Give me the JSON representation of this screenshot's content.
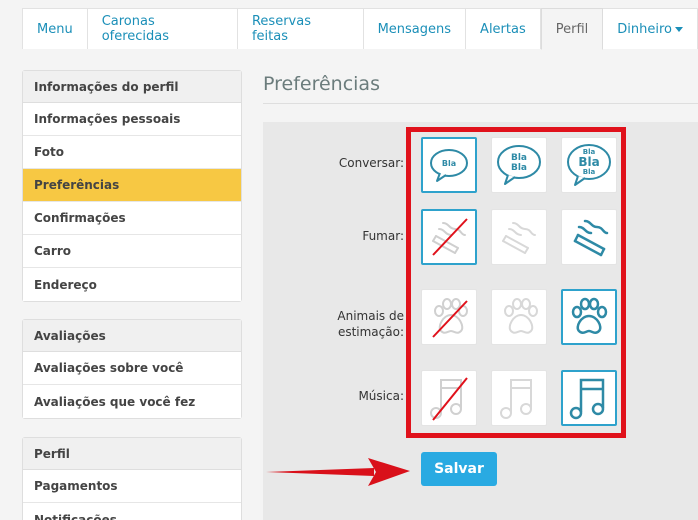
{
  "nav": {
    "tabs": [
      {
        "label": "Menu"
      },
      {
        "label": "Caronas oferecidas"
      },
      {
        "label": "Reservas feitas"
      },
      {
        "label": "Mensagens"
      },
      {
        "label": "Alertas"
      },
      {
        "label": "Perfil"
      },
      {
        "label": "Dinheiro"
      }
    ],
    "active_tab": "Perfil"
  },
  "sidebar": {
    "groups": [
      {
        "title": "Informações do perfil",
        "items": [
          {
            "label": "Informações pessoais"
          },
          {
            "label": "Foto"
          },
          {
            "label": "Preferências"
          },
          {
            "label": "Confirmações"
          },
          {
            "label": "Carro"
          },
          {
            "label": "Endereço"
          }
        ]
      },
      {
        "title": "Avaliações",
        "items": [
          {
            "label": "Avaliações sobre você"
          },
          {
            "label": "Avaliações que você fez"
          }
        ]
      },
      {
        "title": "Perfil",
        "items": [
          {
            "label": "Pagamentos"
          },
          {
            "label": "Notificações"
          }
        ]
      }
    ],
    "active_item": "Preferências"
  },
  "main": {
    "title": "Preferências",
    "preferences": [
      {
        "label": "Conversar:",
        "options": [
          {
            "icon": "bla-chat-icon",
            "text": [
              "Bla"
            ]
          },
          {
            "icon": "blabla-chat-icon",
            "text": [
              "Bla",
              "Bla"
            ]
          },
          {
            "icon": "blablabla-chat-icon",
            "text": [
              "Bla",
              "Bla",
              "Bla"
            ]
          }
        ],
        "selected_index": 0
      },
      {
        "label": "Fumar:",
        "options": [
          {
            "icon": "no-smoking-icon"
          },
          {
            "icon": "smoking-maybe-icon"
          },
          {
            "icon": "smoking-icon"
          }
        ],
        "selected_index": 0
      },
      {
        "label_lines": [
          "Animais de",
          "estimação:"
        ],
        "options": [
          {
            "icon": "no-pets-icon"
          },
          {
            "icon": "pets-maybe-icon"
          },
          {
            "icon": "pets-icon"
          }
        ],
        "selected_index": 2
      },
      {
        "label": "Música:",
        "options": [
          {
            "icon": "no-music-icon"
          },
          {
            "icon": "music-maybe-icon"
          },
          {
            "icon": "music-icon"
          }
        ],
        "selected_index": 2
      }
    ],
    "save_label": "Salvar"
  },
  "colors": {
    "accent": "#29aae2",
    "link": "#1b8fb8",
    "active_sidebar": "#f7c843",
    "annotation_red": "#e0111b",
    "icon_teal": "#2e8aa6"
  }
}
